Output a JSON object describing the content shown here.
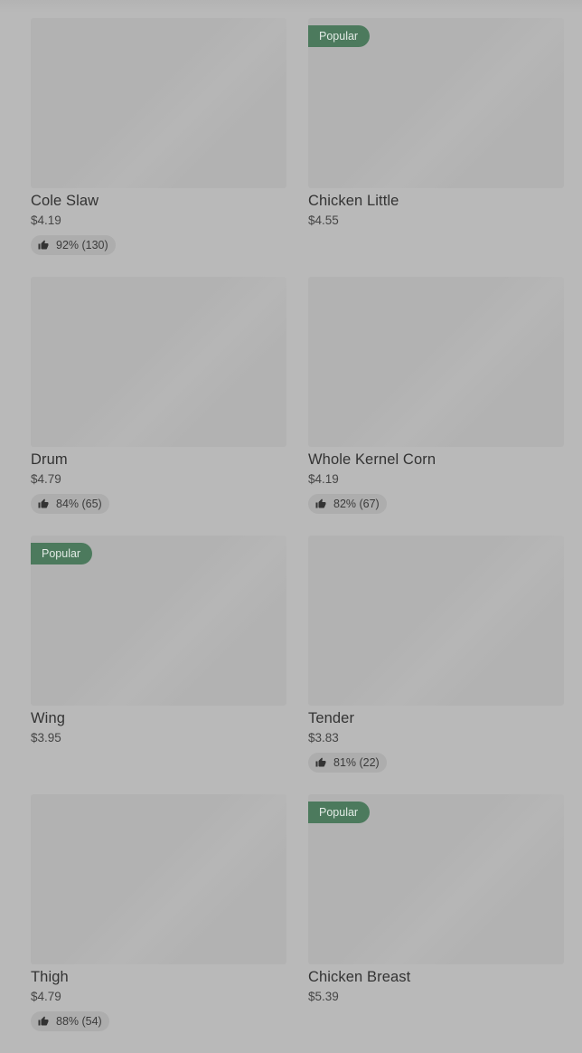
{
  "items": [
    {
      "name": "Cole Slaw",
      "price": "$4.19",
      "popular": "",
      "rating": "92% (130)"
    },
    {
      "name": "Chicken Little",
      "price": "$4.55",
      "popular": "Popular",
      "rating": ""
    },
    {
      "name": "Drum",
      "price": "$4.79",
      "popular": "",
      "rating": "84% (65)"
    },
    {
      "name": "Whole Kernel Corn",
      "price": "$4.19",
      "popular": "",
      "rating": "82% (67)"
    },
    {
      "name": "Wing",
      "price": "$3.95",
      "popular": "Popular",
      "rating": ""
    },
    {
      "name": "Tender",
      "price": "$3.83",
      "popular": "",
      "rating": "81% (22)"
    },
    {
      "name": "Thigh",
      "price": "$4.79",
      "popular": "",
      "rating": "88% (54)"
    },
    {
      "name": "Chicken Breast",
      "price": "$5.39",
      "popular": "Popular",
      "rating": ""
    }
  ],
  "icons": {
    "rating": "thumbs-up-icon"
  },
  "colors": {
    "badge": "#4c7a5d",
    "overlay": "#b9b9b9"
  }
}
